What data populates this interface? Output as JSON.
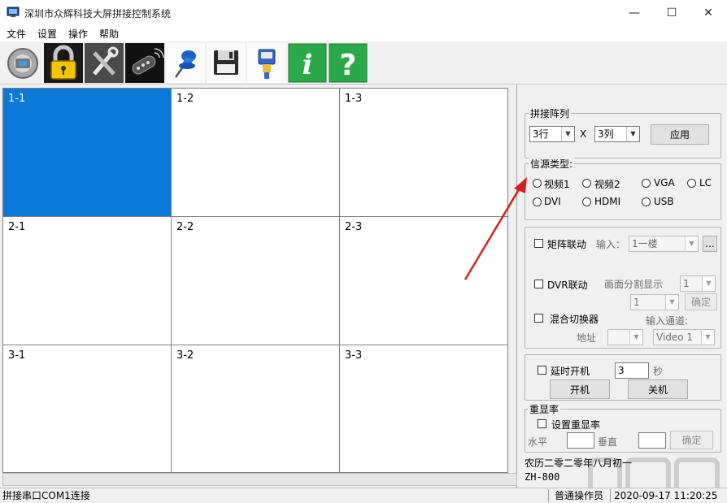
{
  "window": {
    "title": "深圳市众辉科技大屏拼接控制系统",
    "minimize": "—",
    "maximize": "☐",
    "close": "✕"
  },
  "menu": [
    "文件",
    "设置",
    "操作",
    "帮助"
  ],
  "toolbar": {
    "icons": [
      "connect-icon",
      "lock-icon",
      "tools-icon",
      "remote-icon",
      "pin-icon",
      "floppy-save-icon",
      "serial-port-icon",
      "info-icon",
      "help-icon"
    ],
    "info_glyph": "i",
    "help_glyph": "?"
  },
  "grid": {
    "rows": 3,
    "cols": 3,
    "selected": "1-1",
    "cells": [
      "1-1",
      "1-2",
      "1-3",
      "2-1",
      "2-2",
      "2-3",
      "3-1",
      "3-2",
      "3-3"
    ]
  },
  "array": {
    "legend": "拼接阵列",
    "rows_value": "3行",
    "x": "X",
    "cols_value": "3列",
    "apply": "应用"
  },
  "source": {
    "legend": "信源类型:",
    "options": [
      "视频1",
      "视频2",
      "VGA",
      "LC",
      "DVI",
      "HDMI",
      "USB"
    ]
  },
  "matrix": {
    "label": "矩阵联动",
    "input_label": "输入：",
    "input_value": "1一楼",
    "more": "...",
    "dvr_label": "DVR联动",
    "split_label": "画面分割显示",
    "split_value": "1",
    "split2_value": "1",
    "confirm": "确定",
    "mixer_label": "混合切换器",
    "channel_label": "输入通道:",
    "addr_label": "地址",
    "addr_value": "",
    "channel_value": "Video 1"
  },
  "power": {
    "delay_label": "延时开机",
    "delay_value": "3",
    "sec": "秒",
    "on": "开机",
    "off": "关机"
  },
  "refresh": {
    "legend": "重显率",
    "set_label": "设置重显率",
    "h_label": "水平",
    "v_label": "垂直",
    "confirm": "确定"
  },
  "info": {
    "lunar": "农历二零二零年八月初一",
    "model": "ZH-800"
  },
  "status": {
    "serial": "拼接串口COM1连接",
    "user": "普通操作员",
    "datetime": "2020-09-17 11:20:25"
  },
  "colors": {
    "selected_cell": "#0a78d7",
    "arrow": "#d42020",
    "info_button": "#2aa84a"
  }
}
